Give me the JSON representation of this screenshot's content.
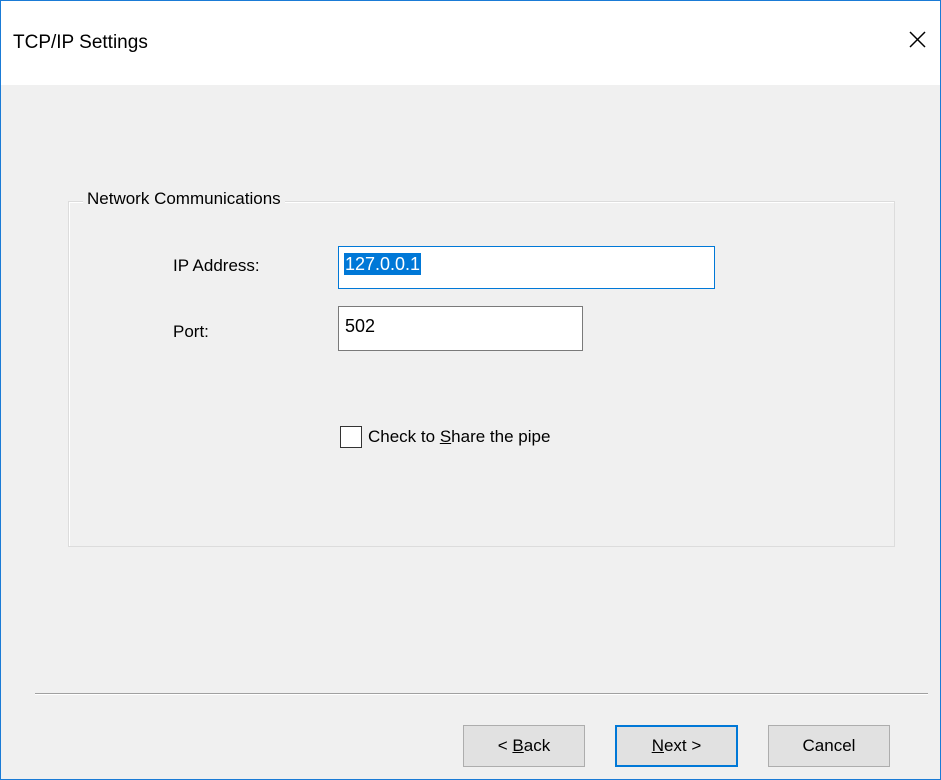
{
  "window": {
    "title": "TCP/IP Settings",
    "close_icon": "close-icon"
  },
  "group": {
    "legend": "Network Communications",
    "ip_label": "IP Address:",
    "ip_value": "127.0.0.1",
    "port_label": "Port:",
    "port_value": "502",
    "share_pipe": {
      "label_before": "Check to ",
      "label_underlined": "S",
      "label_after": "hare the pipe",
      "checked": false
    }
  },
  "buttons": {
    "back": {
      "prefix": "< ",
      "underlined": "B",
      "rest": "ack"
    },
    "next": {
      "underlined": "N",
      "rest": "ext >"
    },
    "cancel": {
      "label": "Cancel"
    }
  },
  "colors": {
    "accent": "#0078d7",
    "window_border": "#1a7bd6",
    "dialog_bg": "#f0f0f0"
  }
}
